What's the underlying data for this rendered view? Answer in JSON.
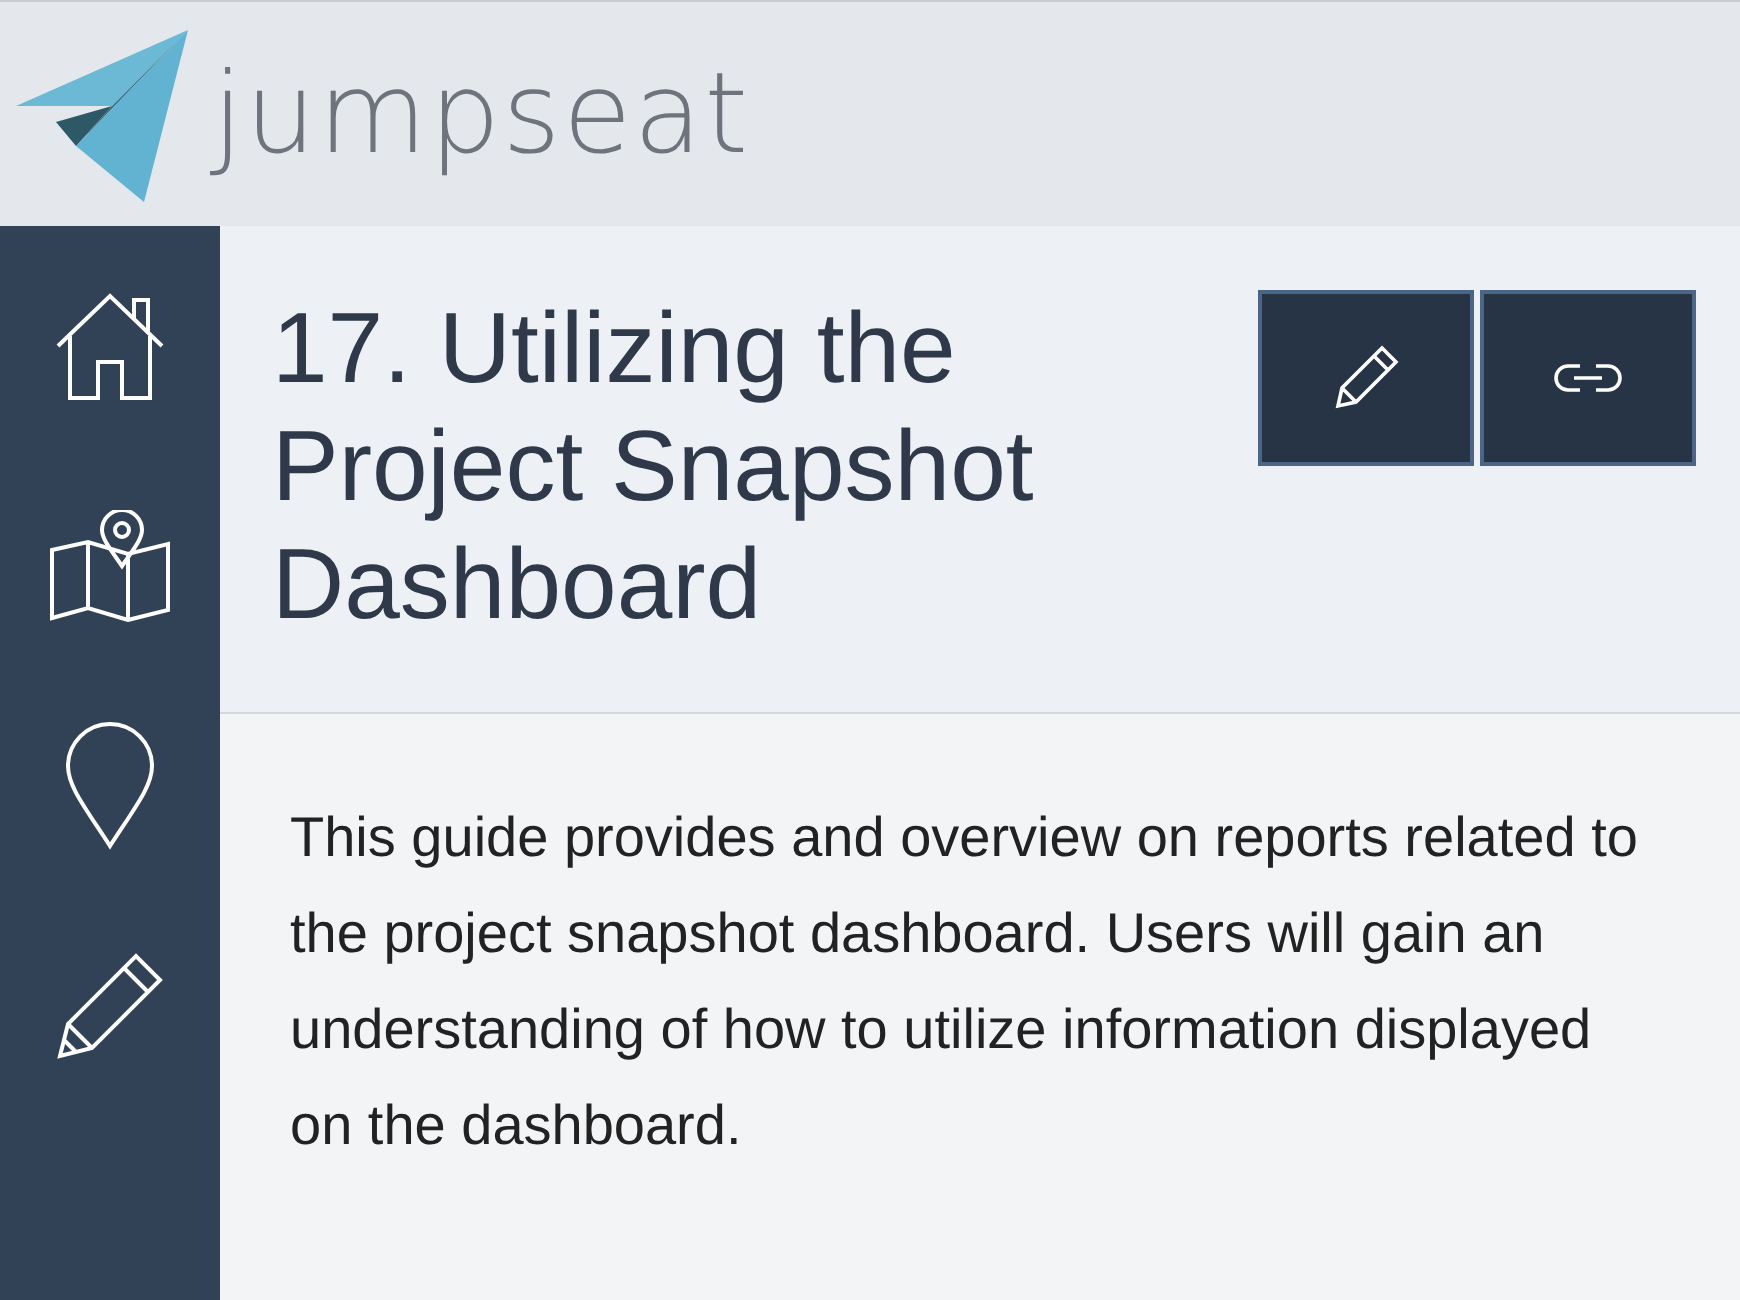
{
  "header": {
    "brand": "jumpseat"
  },
  "sidebar": {
    "items": [
      {
        "kind": "home",
        "selected": false
      },
      {
        "kind": "map",
        "selected": false
      },
      {
        "kind": "pin",
        "selected": false
      },
      {
        "kind": "pencil",
        "selected": false
      }
    ]
  },
  "guide": {
    "title": "17. Utilizing the Project Snapshot Dashboard",
    "actions": [
      {
        "kind": "edit"
      },
      {
        "kind": "link"
      }
    ],
    "description": "This guide provides and overview on reports related to the project snapshot dashboard. Users will gain an understanding of how to utilize information displayed on the dashboard."
  }
}
